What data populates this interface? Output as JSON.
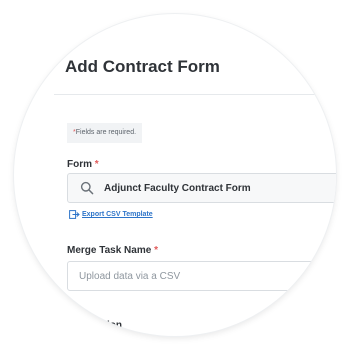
{
  "form_title": "Add Contract Form",
  "required_note": "Fields are required.",
  "form_field": {
    "label": "Form",
    "value": "Adjunct Faculty Contract Form",
    "icon": "search-icon"
  },
  "export_link": {
    "label": "Export CSV Template",
    "icon": "export-icon"
  },
  "merge_task": {
    "label": "Merge Task Name",
    "placeholder": "Upload data via a CSV"
  },
  "description": {
    "label": "Description"
  },
  "colors": {
    "required_star": "#e15a5a",
    "link": "#2d74c9",
    "divider": "#e6e9ec"
  }
}
